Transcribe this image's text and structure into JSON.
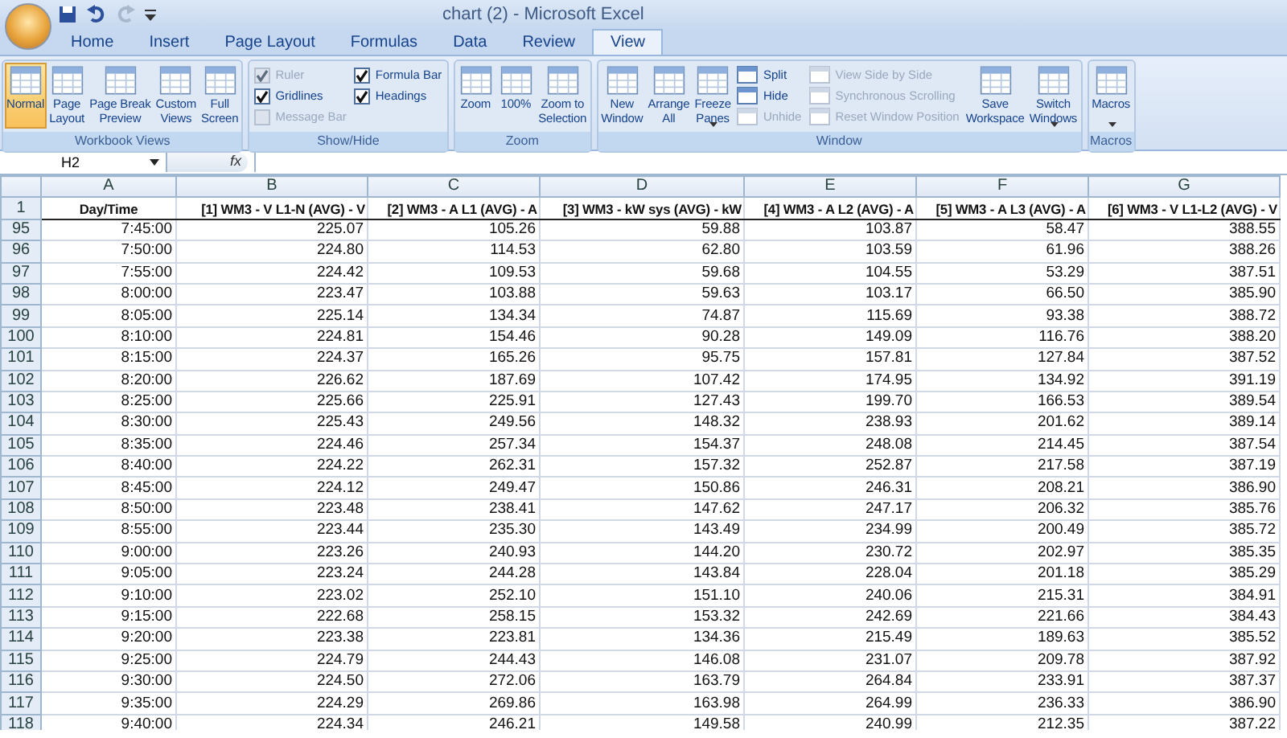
{
  "window": {
    "title": "chart (2) - Microsoft Excel"
  },
  "tabs": [
    {
      "label": "Home",
      "selected": false
    },
    {
      "label": "Insert",
      "selected": false
    },
    {
      "label": "Page Layout",
      "selected": false
    },
    {
      "label": "Formulas",
      "selected": false
    },
    {
      "label": "Data",
      "selected": false
    },
    {
      "label": "Review",
      "selected": false
    },
    {
      "label": "View",
      "selected": true
    }
  ],
  "ribbon": [
    {
      "label": "Workbook Views",
      "items": [
        {
          "kind": "large",
          "label": "Normal",
          "selected": true
        },
        {
          "kind": "large",
          "label": "Page\nLayout",
          "selected": false
        },
        {
          "kind": "large",
          "label": "Page Break\nPreview",
          "selected": false
        },
        {
          "kind": "large",
          "label": "Custom\nViews",
          "selected": false
        },
        {
          "kind": "large",
          "label": "Full\nScreen",
          "selected": false
        }
      ]
    },
    {
      "label": "Show/Hide",
      "items": [
        {
          "kind": "check",
          "label": "Ruler",
          "checked": true,
          "disabled": true
        },
        {
          "kind": "check",
          "label": "Gridlines",
          "checked": true,
          "disabled": false
        },
        {
          "kind": "check",
          "label": "Message Bar",
          "checked": false,
          "disabled": true
        },
        {
          "kind": "check",
          "label": "Formula Bar",
          "checked": true,
          "disabled": false
        },
        {
          "kind": "check",
          "label": "Headings",
          "checked": true,
          "disabled": false
        }
      ]
    },
    {
      "label": "Zoom",
      "items": [
        {
          "kind": "large",
          "label": "Zoom",
          "selected": false
        },
        {
          "kind": "large",
          "label": "100%",
          "selected": false
        },
        {
          "kind": "large",
          "label": "Zoom to\nSelection",
          "selected": false
        }
      ]
    },
    {
      "label": "Window",
      "items": [
        {
          "kind": "large",
          "label": "New\nWindow",
          "selected": false
        },
        {
          "kind": "large",
          "label": "Arrange\nAll",
          "selected": false
        },
        {
          "kind": "large",
          "label": "Freeze\nPanes",
          "selected": false,
          "dropdown": true
        },
        {
          "kind": "small",
          "label": "Split",
          "disabled": false
        },
        {
          "kind": "small",
          "label": "Hide",
          "disabled": false
        },
        {
          "kind": "small",
          "label": "Unhide",
          "disabled": true
        },
        {
          "kind": "small",
          "label": "View Side by Side",
          "disabled": true
        },
        {
          "kind": "small",
          "label": "Synchronous Scrolling",
          "disabled": true
        },
        {
          "kind": "small",
          "label": "Reset Window Position",
          "disabled": true
        },
        {
          "kind": "large",
          "label": "Save\nWorkspace",
          "selected": false
        },
        {
          "kind": "large",
          "label": "Switch\nWindows",
          "selected": false,
          "dropdown": true
        }
      ]
    },
    {
      "label": "Macros",
      "items": [
        {
          "kind": "large",
          "label": "Macros",
          "selected": false,
          "dropdown": true
        }
      ]
    }
  ],
  "formula_bar": {
    "name_box": "H2",
    "function_label": "fx"
  },
  "table": {
    "columns": [
      "A",
      "B",
      "C",
      "D",
      "E",
      "F",
      "G"
    ],
    "header_row": {
      "number": "1",
      "cells": [
        "Day/Time",
        "[1] WM3 - V L1-N (AVG) - V",
        "[2] WM3 - A L1 (AVG) - A",
        "[3] WM3 - kW sys (AVG) - kW",
        "[4] WM3 - A L2 (AVG) - A",
        "[5] WM3 - A L3 (AVG) - A",
        "[6] WM3 - V L1-L2 (AVG) - V"
      ]
    },
    "rows": [
      {
        "number": "95",
        "cells": [
          "7:45:00",
          "225.07",
          "105.26",
          "59.88",
          "103.87",
          "58.47",
          "388.55"
        ]
      },
      {
        "number": "96",
        "cells": [
          "7:50:00",
          "224.80",
          "114.53",
          "62.80",
          "103.59",
          "61.96",
          "388.26"
        ]
      },
      {
        "number": "97",
        "cells": [
          "7:55:00",
          "224.42",
          "109.53",
          "59.68",
          "104.55",
          "53.29",
          "387.51"
        ]
      },
      {
        "number": "98",
        "cells": [
          "8:00:00",
          "223.47",
          "103.88",
          "59.63",
          "103.17",
          "66.50",
          "385.90"
        ]
      },
      {
        "number": "99",
        "cells": [
          "8:05:00",
          "225.14",
          "134.34",
          "74.87",
          "115.69",
          "93.38",
          "388.72"
        ]
      },
      {
        "number": "100",
        "cells": [
          "8:10:00",
          "224.81",
          "154.46",
          "90.28",
          "149.09",
          "116.76",
          "388.20"
        ]
      },
      {
        "number": "101",
        "cells": [
          "8:15:00",
          "224.37",
          "165.26",
          "95.75",
          "157.81",
          "127.84",
          "387.52"
        ]
      },
      {
        "number": "102",
        "cells": [
          "8:20:00",
          "226.62",
          "187.69",
          "107.42",
          "174.95",
          "134.92",
          "391.19"
        ]
      },
      {
        "number": "103",
        "cells": [
          "8:25:00",
          "225.66",
          "225.91",
          "127.43",
          "199.70",
          "166.53",
          "389.54"
        ]
      },
      {
        "number": "104",
        "cells": [
          "8:30:00",
          "225.43",
          "249.56",
          "148.32",
          "238.93",
          "201.62",
          "389.14"
        ]
      },
      {
        "number": "105",
        "cells": [
          "8:35:00",
          "224.46",
          "257.34",
          "154.37",
          "248.08",
          "214.45",
          "387.54"
        ]
      },
      {
        "number": "106",
        "cells": [
          "8:40:00",
          "224.22",
          "262.31",
          "157.32",
          "252.87",
          "217.58",
          "387.19"
        ]
      },
      {
        "number": "107",
        "cells": [
          "8:45:00",
          "224.12",
          "249.47",
          "150.86",
          "246.31",
          "208.21",
          "386.90"
        ]
      },
      {
        "number": "108",
        "cells": [
          "8:50:00",
          "223.48",
          "238.41",
          "147.62",
          "247.17",
          "206.32",
          "385.76"
        ]
      },
      {
        "number": "109",
        "cells": [
          "8:55:00",
          "223.44",
          "235.30",
          "143.49",
          "234.99",
          "200.49",
          "385.72"
        ]
      },
      {
        "number": "110",
        "cells": [
          "9:00:00",
          "223.26",
          "240.93",
          "144.20",
          "230.72",
          "202.97",
          "385.35"
        ]
      },
      {
        "number": "111",
        "cells": [
          "9:05:00",
          "223.24",
          "244.28",
          "143.84",
          "228.04",
          "201.18",
          "385.29"
        ]
      },
      {
        "number": "112",
        "cells": [
          "9:10:00",
          "223.02",
          "252.10",
          "151.10",
          "240.06",
          "215.31",
          "384.91"
        ]
      },
      {
        "number": "113",
        "cells": [
          "9:15:00",
          "222.68",
          "258.15",
          "153.32",
          "242.69",
          "221.66",
          "384.43"
        ]
      },
      {
        "number": "114",
        "cells": [
          "9:20:00",
          "223.38",
          "223.81",
          "134.36",
          "215.49",
          "189.63",
          "385.52"
        ]
      },
      {
        "number": "115",
        "cells": [
          "9:25:00",
          "224.79",
          "244.43",
          "146.08",
          "231.07",
          "209.78",
          "387.92"
        ]
      },
      {
        "number": "116",
        "cells": [
          "9:30:00",
          "224.50",
          "272.06",
          "163.79",
          "264.84",
          "233.91",
          "387.37"
        ]
      },
      {
        "number": "117",
        "cells": [
          "9:35:00",
          "224.29",
          "269.86",
          "163.98",
          "264.99",
          "236.33",
          "386.90"
        ]
      },
      {
        "number": "118",
        "cells": [
          "9:40:00",
          "224.34",
          "246.21",
          "149.58",
          "240.99",
          "212.35",
          "387.22"
        ]
      }
    ]
  }
}
